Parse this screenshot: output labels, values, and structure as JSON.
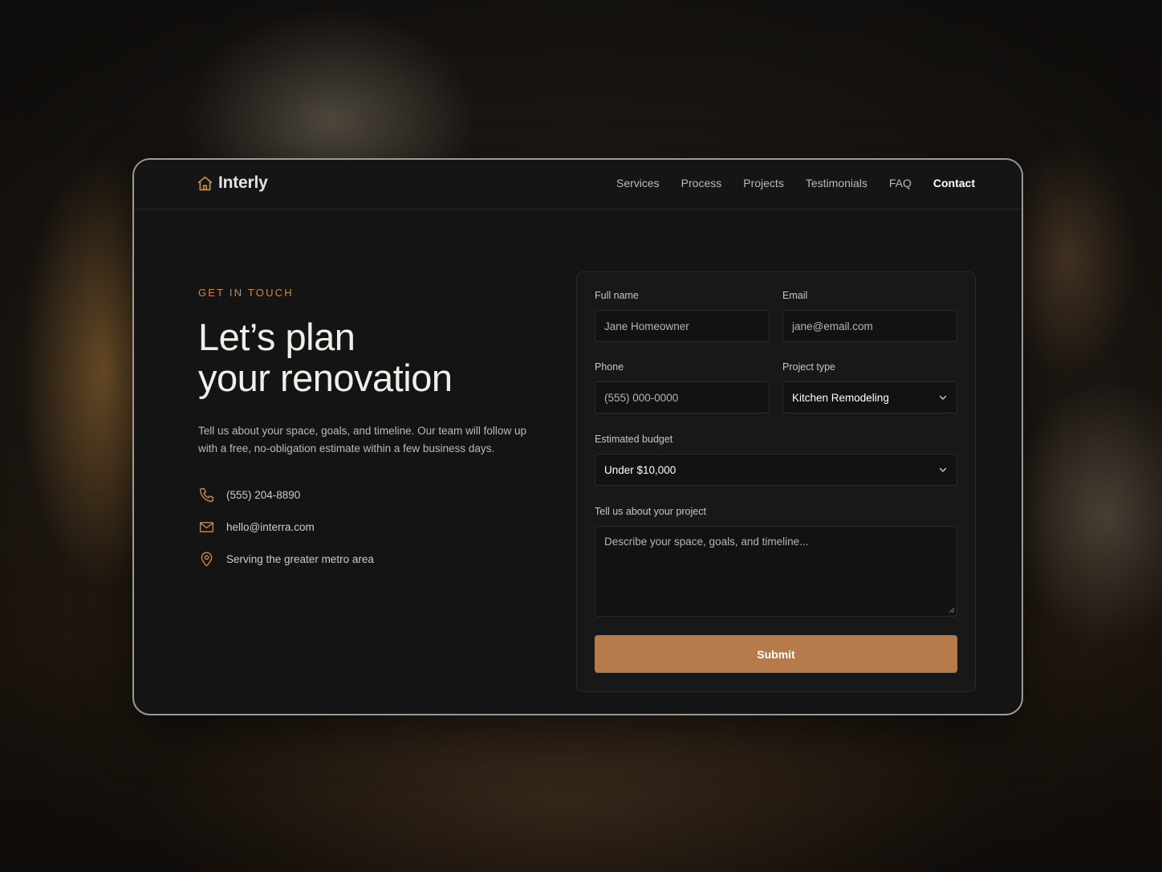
{
  "brand": {
    "name": "Interly",
    "icon": "house-icon",
    "accent_color": "#c98a4d"
  },
  "nav": {
    "links": [
      {
        "label": "Services"
      },
      {
        "label": "Process"
      },
      {
        "label": "Projects"
      },
      {
        "label": "Testimonials"
      },
      {
        "label": "FAQ"
      },
      {
        "label": "Contact",
        "active": true
      }
    ]
  },
  "hero": {
    "eyebrow": "GET IN TOUCH",
    "headline_line1": "Let’s plan",
    "headline_line2": "your renovation",
    "intro": "Tell us about your space, goals, and timeline. Our team will follow up with a free, no-obligation estimate within a few business days."
  },
  "contact": {
    "items": [
      {
        "icon": "phone-icon",
        "text": "(555) 204-8890"
      },
      {
        "icon": "mail-icon",
        "text": "hello@interra.com"
      },
      {
        "icon": "map-pin-icon",
        "text": "Serving the greater metro area"
      }
    ]
  },
  "form": {
    "full_name": {
      "label": "Full name",
      "placeholder": "Jane Homeowner",
      "value": ""
    },
    "email": {
      "label": "Email",
      "placeholder": "jane@email.com",
      "value": ""
    },
    "phone": {
      "label": "Phone",
      "placeholder": "(555) 000-0000",
      "value": ""
    },
    "project_type": {
      "label": "Project type",
      "value": "Kitchen Remodeling"
    },
    "budget": {
      "label": "Estimated budget",
      "value": "Under $10,000"
    },
    "message": {
      "label": "Tell us about your project",
      "placeholder": "Describe your space, goals, and timeline..."
    },
    "submit_label": "Submit",
    "submit_color": "#b57b4a"
  }
}
